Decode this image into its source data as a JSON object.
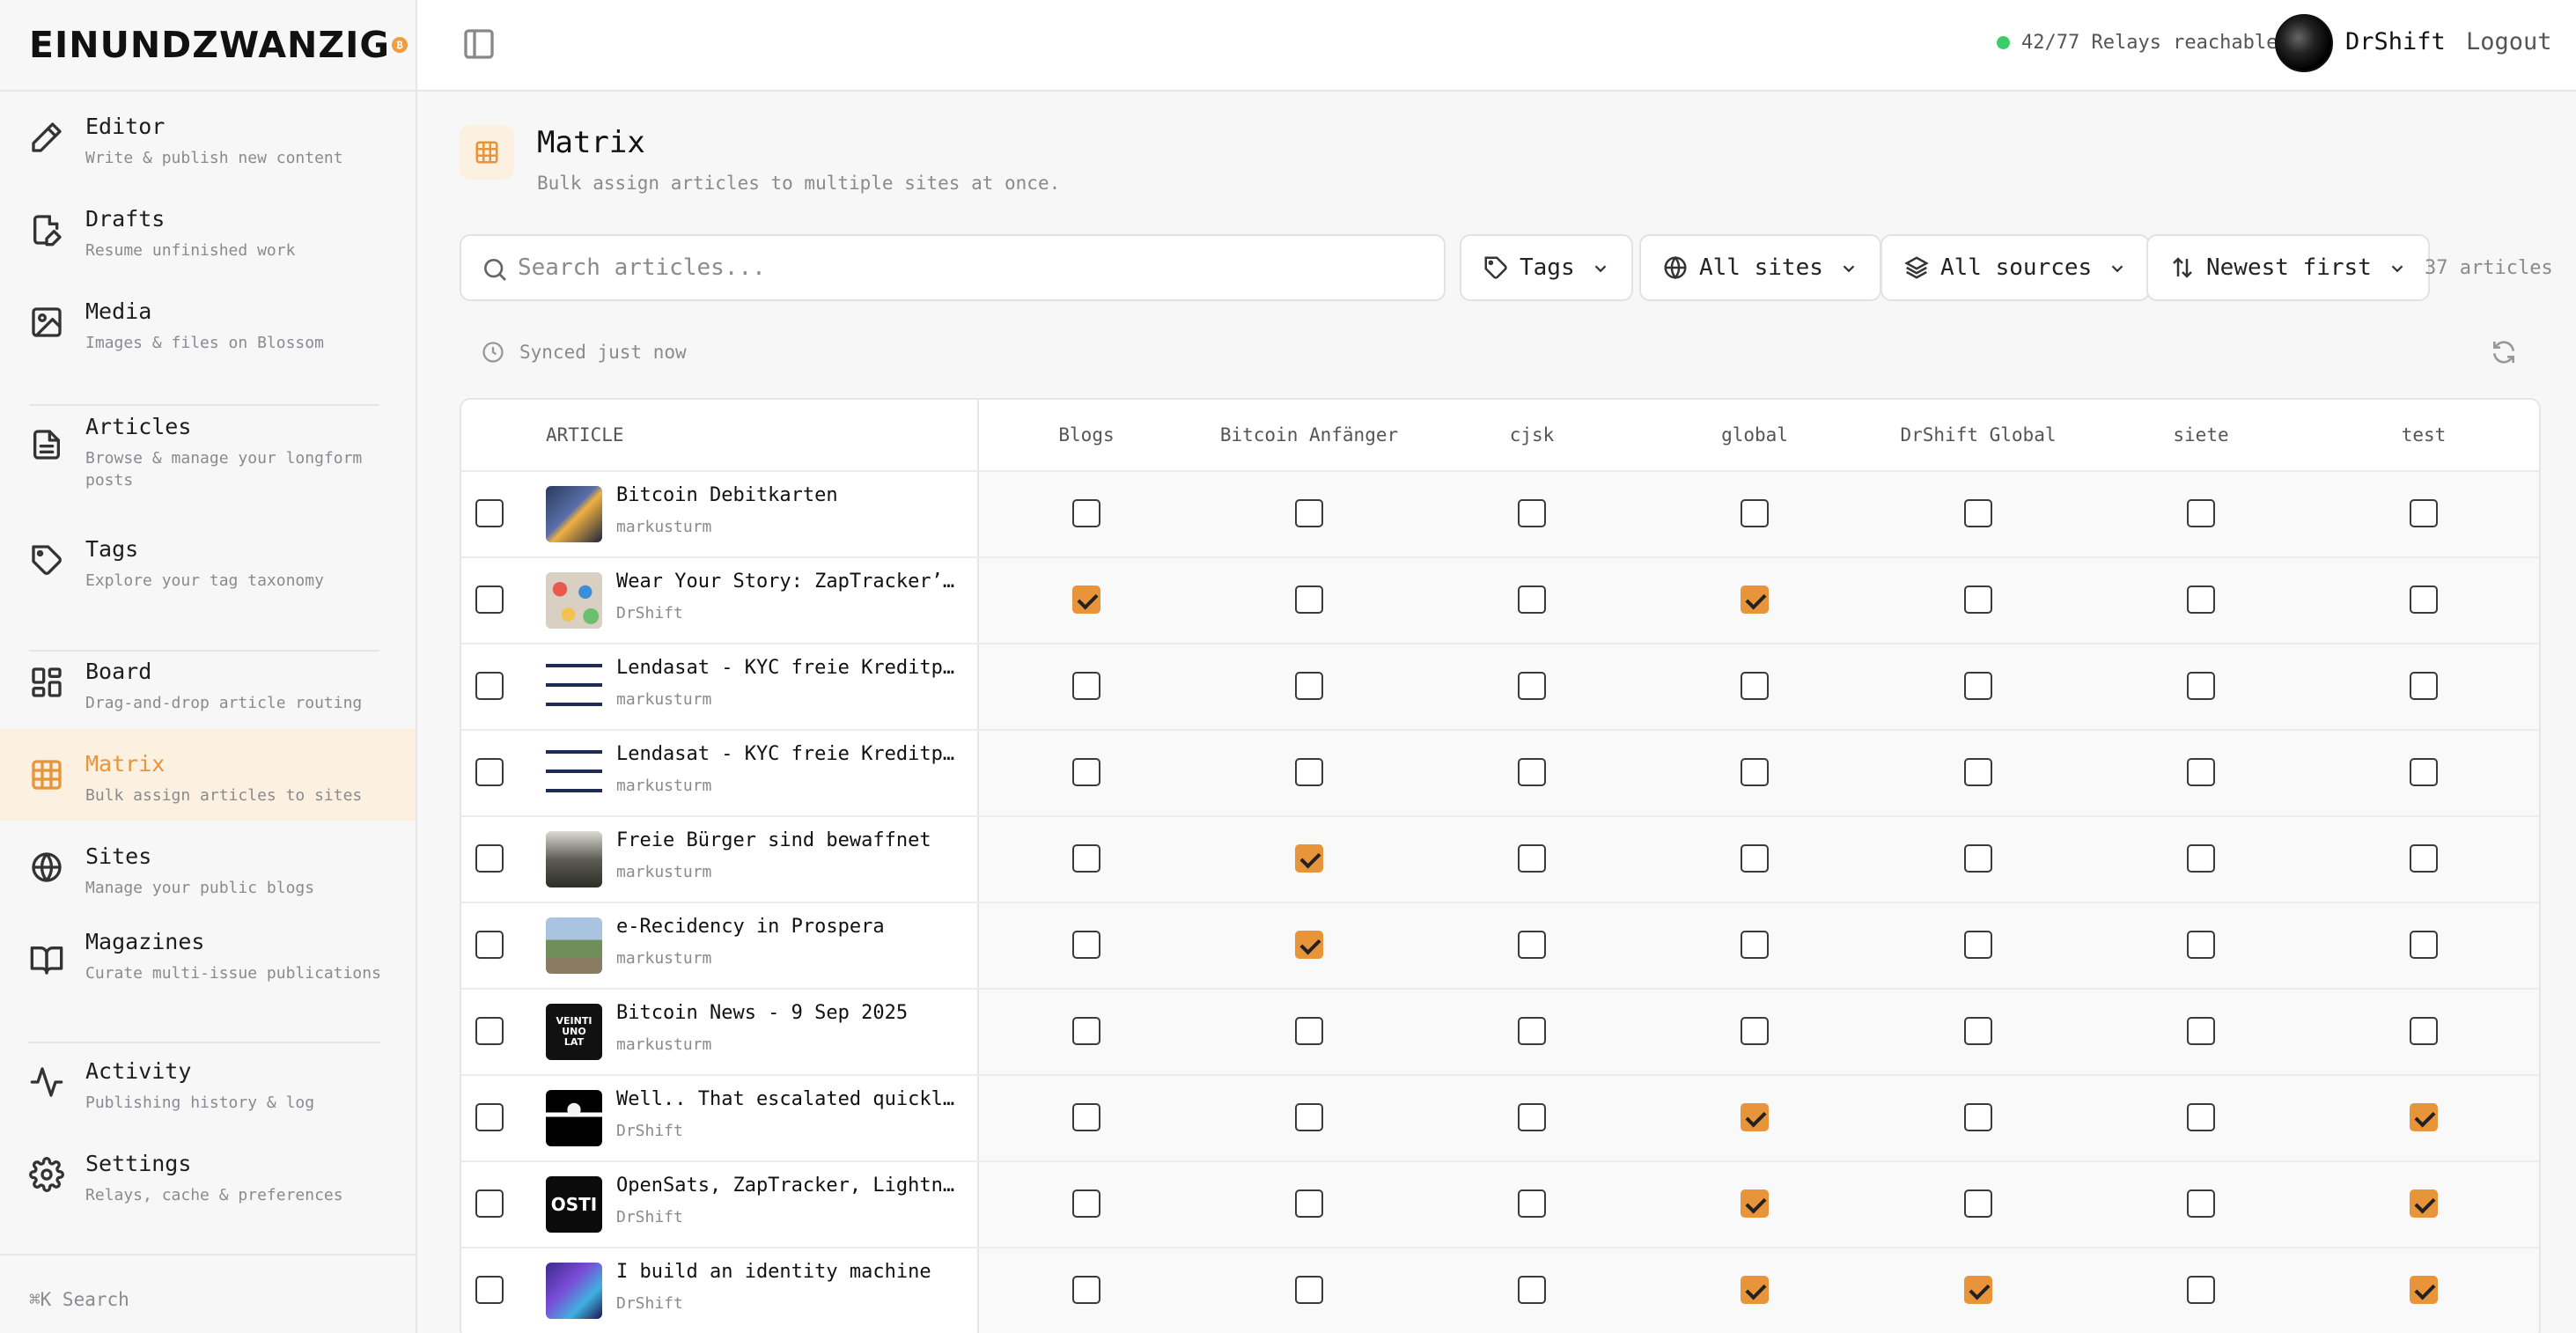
{
  "brand": {
    "name": "EINUNDZWANZIG",
    "badge": "₿"
  },
  "sidebar": {
    "items": [
      {
        "key": "editor",
        "title": "Editor",
        "subtitle": "Write & publish new content",
        "icon": "pencil-icon"
      },
      {
        "key": "drafts",
        "title": "Drafts",
        "subtitle": "Resume unfinished work",
        "icon": "file-pen-icon"
      },
      {
        "key": "media",
        "title": "Media",
        "subtitle": "Images & files on Blossom",
        "icon": "image-icon"
      },
      {
        "key": "articles",
        "title": "Articles",
        "subtitle": "Browse & manage your longform posts",
        "icon": "document-icon"
      },
      {
        "key": "tags",
        "title": "Tags",
        "subtitle": "Explore your tag taxonomy",
        "icon": "tag-icon"
      },
      {
        "key": "board",
        "title": "Board",
        "subtitle": "Drag-and-drop article routing",
        "icon": "board-icon"
      },
      {
        "key": "matrix",
        "title": "Matrix",
        "subtitle": "Bulk assign articles to sites",
        "icon": "grid-icon",
        "active": true
      },
      {
        "key": "sites",
        "title": "Sites",
        "subtitle": "Manage your public blogs",
        "icon": "globe-icon"
      },
      {
        "key": "magazines",
        "title": "Magazines",
        "subtitle": "Curate multi-issue publications",
        "icon": "book-icon"
      },
      {
        "key": "activity",
        "title": "Activity",
        "subtitle": "Publishing history & log",
        "icon": "activity-icon"
      },
      {
        "key": "settings",
        "title": "Settings",
        "subtitle": "Relays, cache & preferences",
        "icon": "gear-icon"
      }
    ],
    "search_hint": "⌘K Search"
  },
  "topbar": {
    "relay_status": "42/77 Relays reachable",
    "username": "DrShift",
    "logout": "Logout"
  },
  "page": {
    "title": "Matrix",
    "subtitle": "Bulk assign articles to multiple sites at once."
  },
  "filters": {
    "search_placeholder": "Search articles...",
    "tags": "Tags",
    "sites": "All sites",
    "sources": "All sources",
    "sort": "Newest first",
    "count": "37 articles"
  },
  "sync": {
    "text": "Synced just now"
  },
  "matrix": {
    "article_header": "ARTICLE",
    "columns": [
      "Blogs",
      "Bitcoin Anfänger",
      "cjsk",
      "global",
      "DrShift Global",
      "siete",
      "test"
    ],
    "rows": [
      {
        "title": "Bitcoin Debitkarten",
        "author": "markusturm",
        "assigned": [
          false,
          false,
          false,
          false,
          false,
          false,
          false
        ]
      },
      {
        "title": "Wear Your Story: ZapTracker’s N…",
        "author": "DrShift",
        "assigned": [
          true,
          false,
          false,
          true,
          false,
          false,
          false
        ]
      },
      {
        "title": "Lendasat - KYC freie Kreditplat…",
        "author": "markusturm",
        "assigned": [
          false,
          false,
          false,
          false,
          false,
          false,
          false
        ]
      },
      {
        "title": "Lendasat - KYC freie Kreditplat…",
        "author": "markusturm",
        "assigned": [
          false,
          false,
          false,
          false,
          false,
          false,
          false
        ]
      },
      {
        "title": "Freie Bürger sind bewaffnet",
        "author": "markusturm",
        "assigned": [
          false,
          true,
          false,
          false,
          false,
          false,
          false
        ]
      },
      {
        "title": "e-Recidency in Prospera",
        "author": "markusturm",
        "assigned": [
          false,
          true,
          false,
          false,
          false,
          false,
          false
        ]
      },
      {
        "title": "Bitcoin News - 9 Sep 2025",
        "author": "markusturm",
        "assigned": [
          false,
          false,
          false,
          false,
          false,
          false,
          false
        ]
      },
      {
        "title": "Well.. That escalated quickly -…",
        "author": "DrShift",
        "assigned": [
          false,
          false,
          false,
          true,
          false,
          false,
          true
        ]
      },
      {
        "title": "OpenSats, ZapTracker, Lightning…",
        "author": "DrShift",
        "assigned": [
          false,
          false,
          false,
          true,
          false,
          false,
          true
        ]
      },
      {
        "title": "I build an identity machine",
        "author": "DrShift",
        "assigned": [
          false,
          false,
          false,
          true,
          true,
          false,
          true
        ]
      }
    ]
  },
  "colors": {
    "accent": "#e8943a",
    "accent_bg": "#fcf1e0",
    "online": "#3ecb6a"
  }
}
